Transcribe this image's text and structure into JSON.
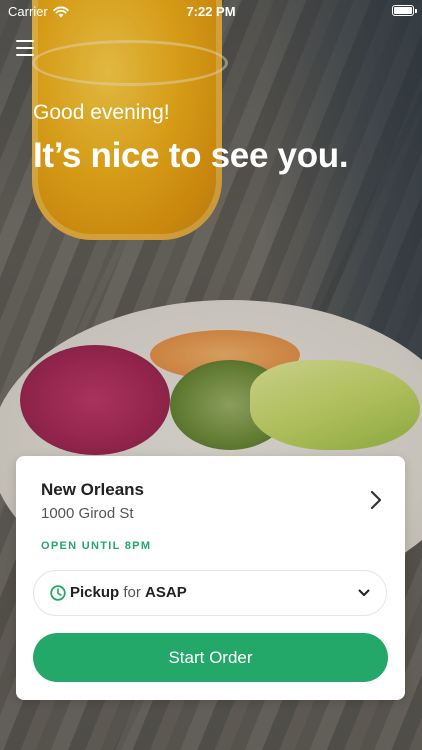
{
  "status_bar": {
    "carrier": "Carrier",
    "time": "7:22 PM",
    "icons": [
      "wifi-icon",
      "battery-icon"
    ]
  },
  "header": {
    "menu_icon": "hamburger-menu-icon",
    "greeting": "Good evening!",
    "headline": "It’s nice to see you."
  },
  "location_card": {
    "name": "New Orleans",
    "address": "1000 Girod St",
    "hours": "OPEN UNTIL 8PM",
    "chevron_icon": "chevron-right-icon",
    "pickup": {
      "icon": "clock-icon",
      "mode": "Pickup",
      "connector": "for",
      "time": "ASAP",
      "dropdown_icon": "chevron-down-icon"
    },
    "cta_label": "Start Order"
  },
  "colors": {
    "accent_green": "#24a86a",
    "card_background": "#ffffff",
    "text_primary": "#222222",
    "text_secondary": "#555555"
  }
}
